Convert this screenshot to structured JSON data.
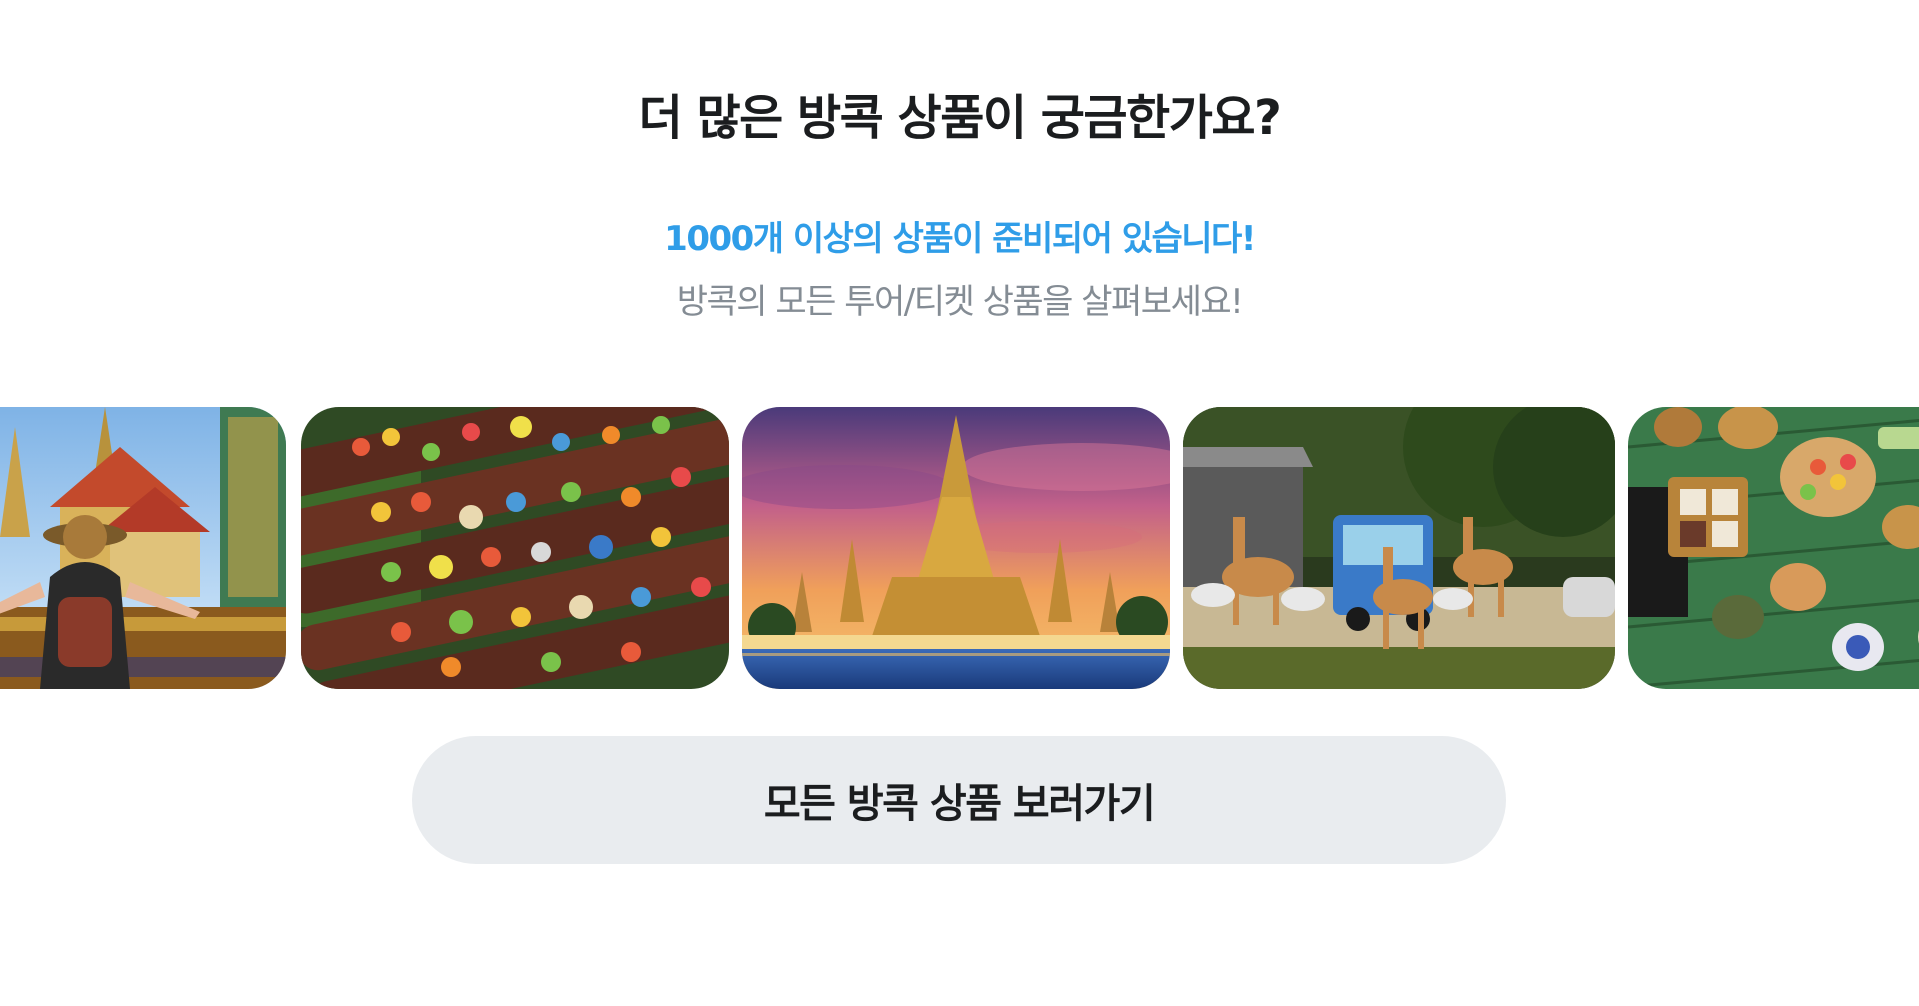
{
  "section": {
    "title": "더 많은 방콕 상품이 궁금한가요?",
    "highlight": "1000개 이상의 상품이 준비되어 있습니다!",
    "description": "방콕의 모든 투어/티켓 상품을 살펴보세요!"
  },
  "gallery": {
    "items": [
      {
        "subject": "grand-palace-traveler"
      },
      {
        "subject": "floating-market-boats"
      },
      {
        "subject": "wat-arun-sunset"
      },
      {
        "subject": "safari-park-giraffes"
      },
      {
        "subject": "thai-food-table"
      }
    ]
  },
  "cta": {
    "label": "모든 방콕 상품 보러가기"
  },
  "colors": {
    "accent": "#2f9de8",
    "title": "#1b1d1f",
    "muted": "#848c94",
    "button_bg": "#e9ecef"
  }
}
